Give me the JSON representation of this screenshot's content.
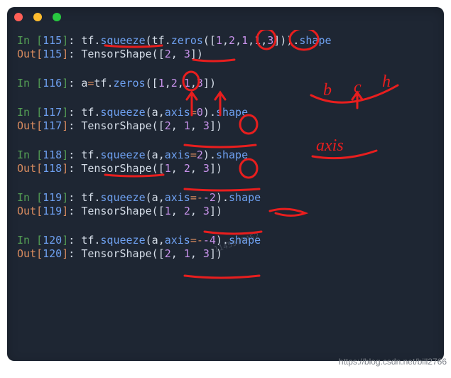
{
  "titlebar": {
    "close_color": "#ff5f57",
    "minimize_color": "#febc2e",
    "zoom_color": "#28c840"
  },
  "cells": {
    "c115": {
      "in_prompt": "In ",
      "in_n": "115",
      "out_prompt": "Out",
      "out_n": "115",
      "obj": "tf",
      "m1": "squeeze",
      "obj2": "tf",
      "m2": "zeros",
      "arr": [
        "1",
        "2",
        "1",
        "1",
        "3"
      ],
      "tail": "shape",
      "result_head": "TensorShape",
      "result_vals": [
        "2",
        "3"
      ]
    },
    "c116": {
      "in_prompt": "In ",
      "in_n": "116",
      "var": "a",
      "obj": "tf",
      "m": "zeros",
      "arr": [
        "1",
        "2",
        "1",
        "3"
      ]
    },
    "c117": {
      "in_prompt": "In ",
      "in_n": "117",
      "out_prompt": "Out",
      "out_n": "117",
      "obj": "tf",
      "m": "squeeze",
      "arg": "a",
      "kw": "axis",
      "val": "0",
      "tail": "shape",
      "result_head": "TensorShape",
      "result_vals": [
        "2",
        "1",
        "3"
      ]
    },
    "c118": {
      "in_prompt": "In ",
      "in_n": "118",
      "out_prompt": "Out",
      "out_n": "118",
      "obj": "tf",
      "m": "squeeze",
      "arg": "a",
      "kw": "axis",
      "val": "2",
      "tail": "shape",
      "result_head": "TensorShape",
      "result_vals": [
        "1",
        "2",
        "3"
      ]
    },
    "c119": {
      "in_prompt": "In ",
      "in_n": "119",
      "out_prompt": "Out",
      "out_n": "119",
      "obj": "tf",
      "m": "squeeze",
      "arg": "a",
      "kw": "axis",
      "val": "-2",
      "tail": "shape",
      "result_head": "TensorShape",
      "result_vals": [
        "1",
        "2",
        "3"
      ]
    },
    "c120": {
      "in_prompt": "In ",
      "in_n": "120",
      "out_prompt": "Out",
      "out_n": "120",
      "obj": "tf",
      "m": "squeeze",
      "arg": "a",
      "kw": "axis",
      "val": "-4",
      "tail": "shape",
      "result_head": "TensorShape",
      "result_vals": [
        "2",
        "1",
        "3"
      ]
    }
  },
  "annotations": {
    "hand_b": "b",
    "hand_c": "c",
    "hand_h": "h",
    "hand_axis": "axis"
  },
  "watermark_num": "1145979452",
  "credit": "https://blog.csdn.net/bill2766"
}
